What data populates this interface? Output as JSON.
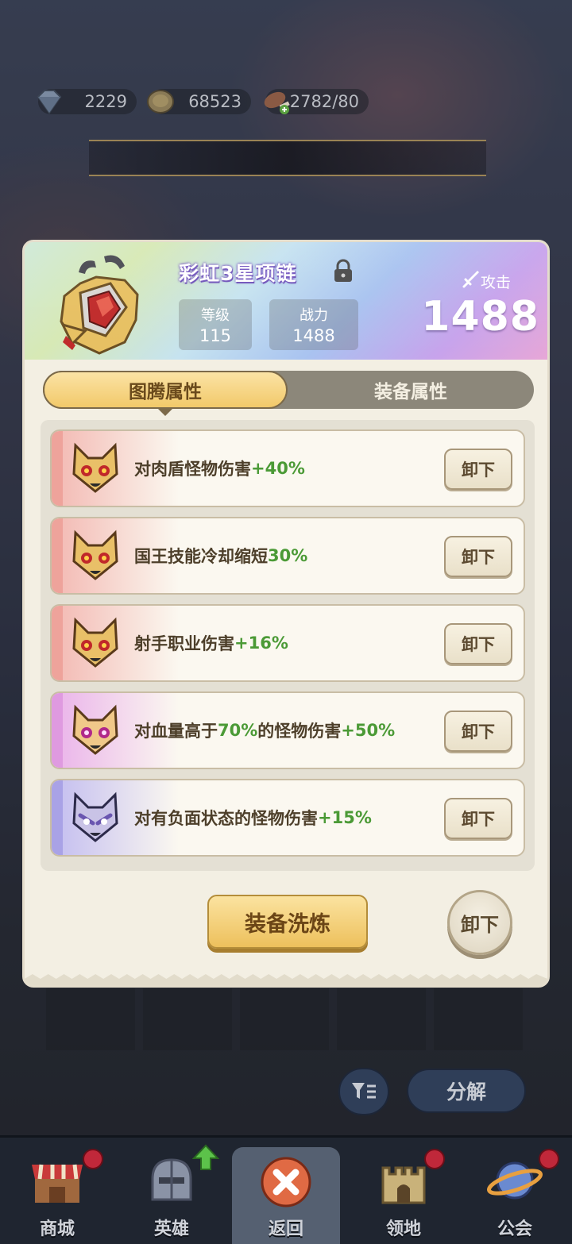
{
  "resources": {
    "gems": "2229",
    "coins": "68523",
    "meat": "2782/80"
  },
  "item": {
    "name": "彩虹3星项链",
    "level_label": "等级",
    "level": "115",
    "power_label": "战力",
    "power": "1488",
    "attack_label": "攻击",
    "attack": "1488"
  },
  "tabs": [
    {
      "label": "图腾属性",
      "active": true
    },
    {
      "label": "装备属性",
      "active": false
    }
  ],
  "totems": [
    {
      "pre": "对肉盾怪物伤害",
      "hl": "+40%",
      "post": "",
      "tier": "red",
      "button": "卸下"
    },
    {
      "pre": "国王技能冷却缩短",
      "hl": "30%",
      "post": "",
      "tier": "red",
      "button": "卸下"
    },
    {
      "pre": "射手职业伤害",
      "hl": "+16%",
      "post": "",
      "tier": "red",
      "button": "卸下"
    },
    {
      "pre": "对血量高于",
      "hl": "70%",
      "post": "的怪物伤害",
      "hl2": "+50%",
      "tier": "pink",
      "button": "卸下"
    },
    {
      "pre": "对有负面状态的怪物伤害",
      "hl": "+15%",
      "post": "",
      "tier": "purple",
      "button": "卸下"
    }
  ],
  "actions": {
    "refine": "装备洗炼",
    "unequip": "卸下",
    "decompose": "分解"
  },
  "nav": [
    {
      "label": "商城",
      "badge": true
    },
    {
      "label": "英雄",
      "badge": false,
      "arrow": true
    },
    {
      "label": "返回",
      "active": true
    },
    {
      "label": "领地",
      "badge": true
    },
    {
      "label": "公会",
      "badge": true
    }
  ],
  "colors": {
    "highlight_green": "#4b9a36",
    "gold_button": "#edc05c",
    "badge_red": "#c0283a"
  }
}
